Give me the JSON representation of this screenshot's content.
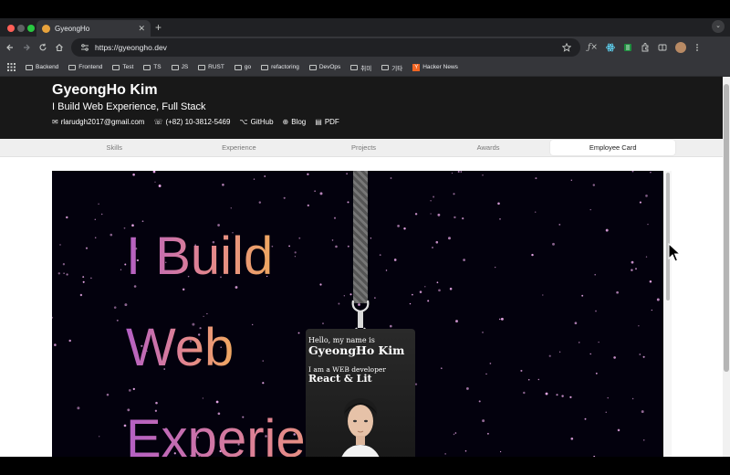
{
  "browser": {
    "tab_title": "GyeongHo",
    "close_glyph": "✕",
    "new_tab_glyph": "+",
    "tab_menu_glyph": "⌄",
    "url": "https://gyeongho.dev",
    "icons": [
      "back-icon",
      "forward-icon",
      "reload-icon",
      "home-icon",
      "site-info-icon",
      "bookmark-star-icon",
      "extensions-icon",
      "profile-avatar-icon",
      "menu-icon"
    ],
    "bookmarks": [
      "Backend",
      "Frontend",
      "Test",
      "TS",
      "JS",
      "RUST",
      "go",
      "refactoring",
      "DevOps",
      "취미",
      "기타"
    ],
    "hn_label": "Hacker News",
    "hn_glyph": "Y"
  },
  "header": {
    "name": "GyeongHo Kim",
    "tagline": "I Build Web Experience, Full Stack",
    "email": "rlarudgh2017@gmail.com",
    "phone": "(+82) 10-3812-5469",
    "github": "GitHub",
    "blog": "Blog",
    "pdf": "PDF"
  },
  "nav": {
    "tabs": [
      "Skills",
      "Experience",
      "Projects",
      "Awards",
      "Employee Card"
    ],
    "active_index": 4
  },
  "hero": {
    "line1": "I Build",
    "line2": "Web",
    "line3": "Experience"
  },
  "card": {
    "hello": "Hello, my name is",
    "name": "GyeongHo Kim",
    "role": "I am a WEB developer",
    "stack": "React & Lit"
  },
  "colors": {
    "header_bg": "#181818",
    "stage_bg": "#03010d",
    "gradient_start": "#b35fc4",
    "gradient_end": "#f0a860",
    "star_color": "#e9a8e8"
  }
}
